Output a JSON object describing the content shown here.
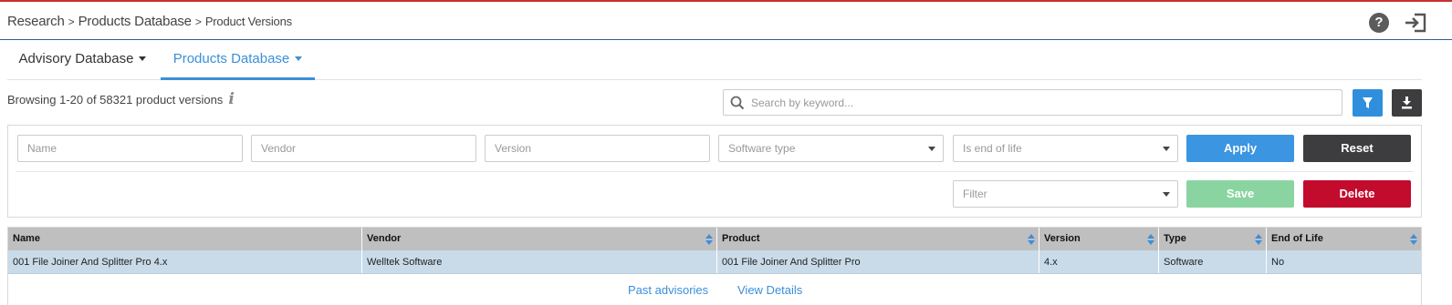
{
  "breadcrumb": {
    "items": [
      "Research",
      "Products Database",
      "Product Versions"
    ],
    "separator": ">"
  },
  "header_icons": [
    "help-icon",
    "logout-icon"
  ],
  "tabs": [
    {
      "label": "Advisory Database",
      "active": false
    },
    {
      "label": "Products Database",
      "active": true
    }
  ],
  "browse": {
    "text": "Browsing 1-20 of 58321 product versions",
    "info_icon": "i"
  },
  "search": {
    "placeholder": "Search by keyword..."
  },
  "filters": {
    "name_placeholder": "Name",
    "vendor_placeholder": "Vendor",
    "version_placeholder": "Version",
    "software_type": "Software type",
    "end_of_life": "Is end of life",
    "apply_label": "Apply",
    "reset_label": "Reset",
    "filter_select": "Filter",
    "save_label": "Save",
    "delete_label": "Delete"
  },
  "table": {
    "columns": [
      "Name",
      "Vendor",
      "Product",
      "Version",
      "Type",
      "End of Life"
    ],
    "rows": [
      [
        "001 File Joiner And Splitter Pro 4.x",
        "Welltek Software",
        "001 File Joiner And Splitter Pro",
        "4.x",
        "Software",
        "No"
      ]
    ]
  },
  "row_links": {
    "past_advisories": "Past advisories",
    "view_details": "View Details"
  },
  "colors": {
    "accent": "#3b8fd8",
    "apply": "#3b95e1",
    "reset": "#3d3d3f",
    "save": "#8ad4a1",
    "delete": "#c30b2e",
    "header_row": "#bfbfbf",
    "selected_row": "#c9dbe9",
    "top_border": "#c9302c"
  }
}
